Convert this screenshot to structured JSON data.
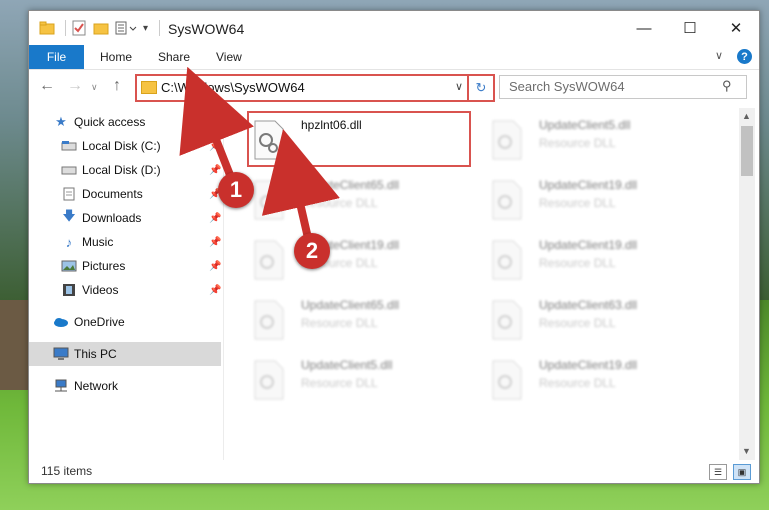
{
  "window": {
    "title": "SysWOW64"
  },
  "ribbon": {
    "tabs": [
      "File",
      "Home",
      "Share",
      "View"
    ],
    "help_label": "?"
  },
  "nav": {
    "address": "C:\\Windows\\SysWOW64",
    "search_placeholder": "Search SysWOW64"
  },
  "sidebar": {
    "items": [
      {
        "label": "Quick access",
        "icon": "star-icon"
      },
      {
        "label": "Local Disk (C:)",
        "icon": "drive-icon"
      },
      {
        "label": "Local Disk (D:)",
        "icon": "drive-icon"
      },
      {
        "label": "Documents",
        "icon": "documents-icon"
      },
      {
        "label": "Downloads",
        "icon": "download-icon"
      },
      {
        "label": "Music",
        "icon": "music-icon"
      },
      {
        "label": "Pictures",
        "icon": "pictures-icon"
      },
      {
        "label": "Videos",
        "icon": "videos-icon"
      },
      {
        "label": "OneDrive",
        "icon": "cloud-icon"
      },
      {
        "label": "This PC",
        "icon": "computer-icon"
      },
      {
        "label": "Network",
        "icon": "network-icon"
      }
    ]
  },
  "files": [
    {
      "name": "hpzlnt06.dll",
      "type": ""
    },
    {
      "name": "UpdateClient5.dll",
      "type": "Resource DLL"
    },
    {
      "name": "UpdateClient65.dll",
      "type": "Resource DLL"
    },
    {
      "name": "UpdateClient19.dll",
      "type": "Resource DLL"
    },
    {
      "name": "UpdateClient19.dll",
      "type": "Resource DLL"
    },
    {
      "name": "UpdateClient19.dll",
      "type": "Resource DLL"
    },
    {
      "name": "UpdateClient65.dll",
      "type": "Resource DLL"
    },
    {
      "name": "UpdateClient63.dll",
      "type": "Resource DLL"
    },
    {
      "name": "UpdateClient5.dll",
      "type": "Resource DLL"
    },
    {
      "name": "UpdateClient19.dll",
      "type": "Resource DLL"
    }
  ],
  "status": {
    "item_count": "115 items"
  },
  "callouts": [
    "1",
    "2"
  ],
  "colors": {
    "accent": "#1979ca",
    "highlight": "#d9534f",
    "callout": "#c9302c"
  }
}
